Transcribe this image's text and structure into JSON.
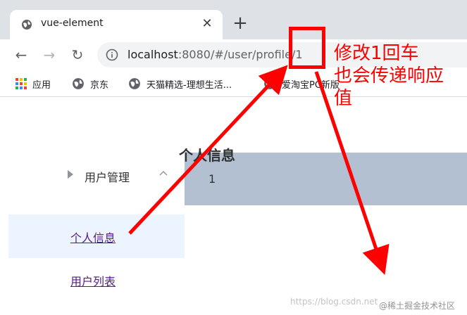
{
  "browser": {
    "tab": {
      "title": "vue-element",
      "close_glyph": "✕"
    },
    "new_tab_glyph": "+",
    "nav": {
      "back_glyph": "←",
      "forward_glyph": "→",
      "reload_glyph": "↻"
    },
    "address": {
      "host": "localhost",
      "rest": ":8080/#/user/profile/1"
    },
    "bookmarks": [
      {
        "label": "应用",
        "icon": "apps-grid-icon"
      },
      {
        "label": "京东",
        "icon": "globe-icon"
      },
      {
        "label": "天猫精选-理想生活...",
        "icon": "globe-icon"
      },
      {
        "label": "爱淘宝PC新版",
        "icon": "globe-icon"
      }
    ]
  },
  "sidebar": {
    "group_label": "用户管理",
    "items": [
      {
        "label": "个人信息",
        "active": true
      },
      {
        "label": "用户列表",
        "active": false
      }
    ]
  },
  "main": {
    "title": "个人信息",
    "id_value": "1"
  },
  "annotation": {
    "line1": "修改1回车",
    "line2": "也会传递响应",
    "line3": "值",
    "color": "#ff0000"
  },
  "watermark": {
    "url_text": "https://blog.csdn.net",
    "site_text": "@稀土掘金技术社区"
  }
}
